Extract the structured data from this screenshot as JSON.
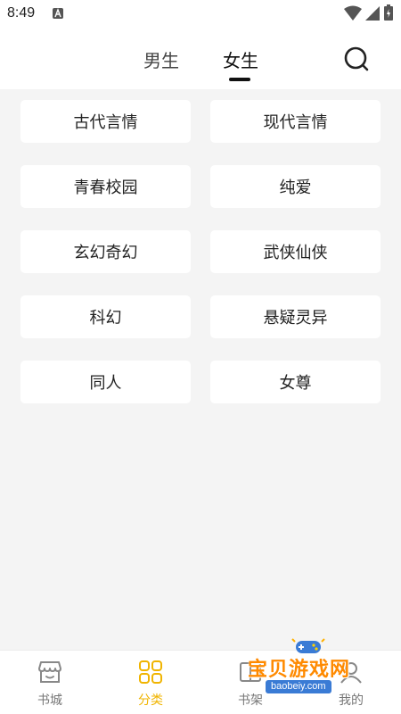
{
  "status_bar": {
    "time": "8:49"
  },
  "header": {
    "tabs": [
      {
        "label": "男生"
      },
      {
        "label": "女生"
      }
    ],
    "active_tab": "女生"
  },
  "categories": [
    "古代言情",
    "现代言情",
    "青春校园",
    "纯爱",
    "玄幻奇幻",
    "武侠仙侠",
    "科幻",
    "悬疑灵异",
    "同人",
    "女尊"
  ],
  "bottom_nav": {
    "items": [
      {
        "label": "书城",
        "icon": "store-icon"
      },
      {
        "label": "分类",
        "icon": "grid-icon"
      },
      {
        "label": "书架",
        "icon": "bookshelf-icon"
      },
      {
        "label": "我的",
        "icon": "profile-icon"
      }
    ],
    "active": "分类"
  },
  "watermark": {
    "text": "宝贝游戏网",
    "url": "baobeiy.com"
  },
  "colors": {
    "accent": "#f0b400",
    "background": "#f4f4f4",
    "card": "#ffffff",
    "watermark": "#ff8a00"
  }
}
